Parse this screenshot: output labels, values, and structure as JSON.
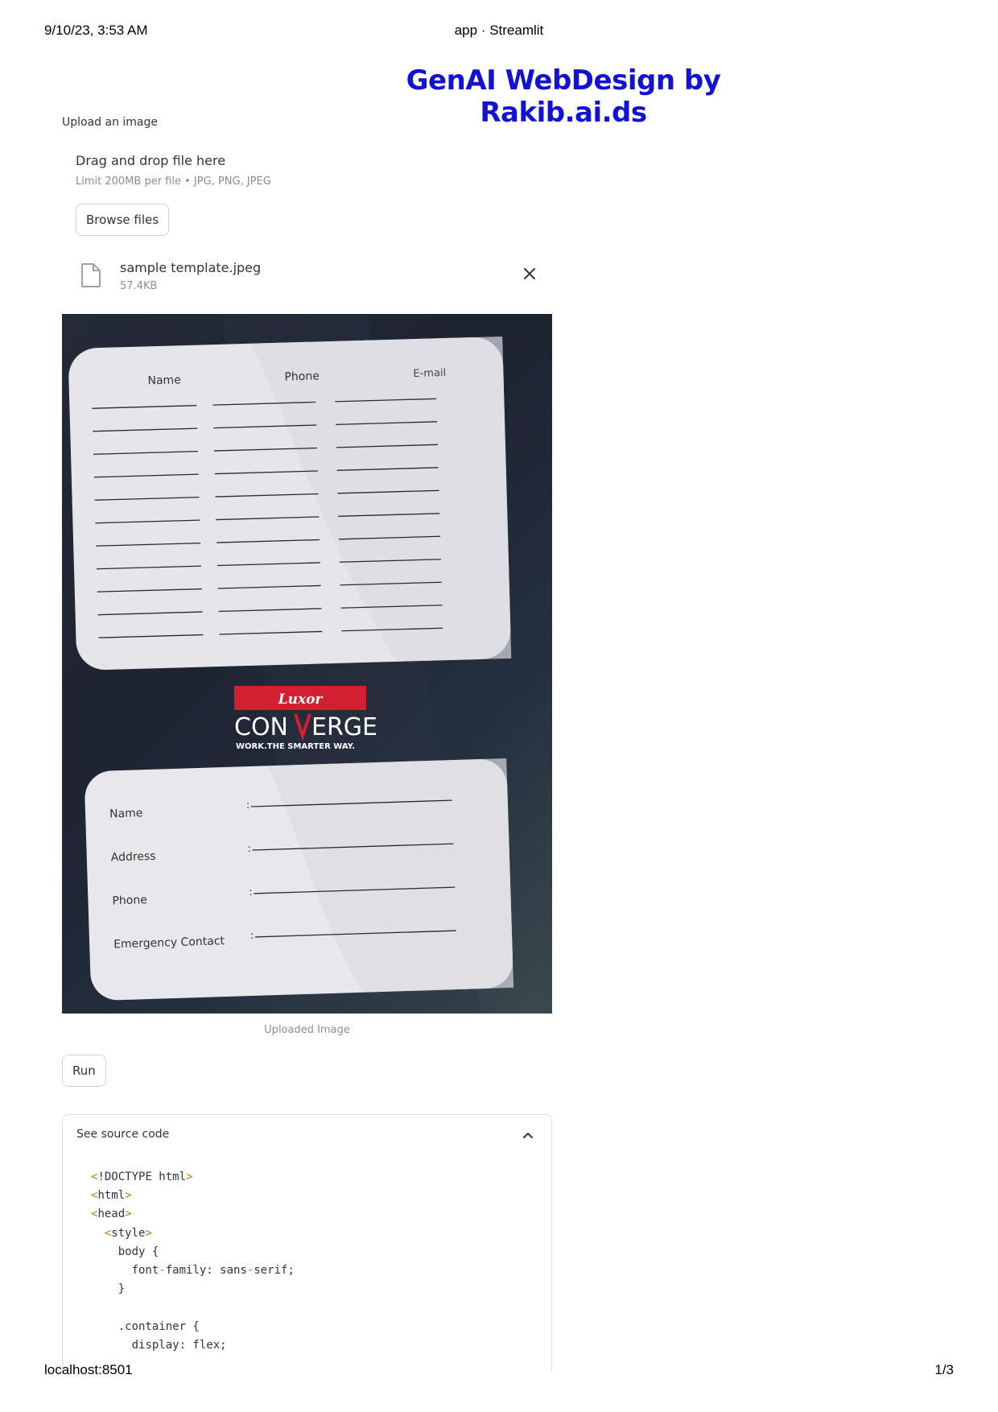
{
  "print": {
    "date": "9/10/23, 3:53 AM",
    "title": "app · Streamlit",
    "url": "localhost:8501",
    "page": "1/3"
  },
  "app": {
    "title": "GenAI WebDesign by Rakib.ai.ds"
  },
  "uploader": {
    "label": "Upload an image",
    "dropzone_title": "Drag and drop file here",
    "dropzone_limit": "Limit 200MB per file • JPG, PNG, JPEG",
    "browse_label": "Browse files",
    "file": {
      "name": "sample template.jpeg",
      "size": "57.4KB",
      "icon": "file-icon"
    }
  },
  "image": {
    "caption": "Uploaded Image",
    "top_card": {
      "headers": [
        "Name",
        "Phone",
        "E-mail"
      ]
    },
    "logo": {
      "brand": "Luxor",
      "name_left": "CON",
      "name_right": "ERGE",
      "tagline": "WORK.THE SMARTER WAY."
    },
    "bottom_card": {
      "fields": [
        "Name",
        "Address",
        "Phone",
        "Emergency Contact"
      ]
    }
  },
  "run": {
    "label": "Run"
  },
  "expander": {
    "label": "See source code",
    "icon": "chevron-up-icon",
    "code_lines": [
      "<!DOCTYPE html>",
      "<html>",
      "<head>",
      "  <style>",
      "    body {",
      "      font-family: sans-serif;",
      "    }",
      "",
      "    .container {",
      "      display: flex;"
    ]
  },
  "colors": {
    "title_blue": "#1212d4",
    "text": "#31333f",
    "muted": "#8a8d96",
    "border": "#d0d1d6",
    "code_tag": "#c2771a",
    "logo_red": "#d32030"
  }
}
